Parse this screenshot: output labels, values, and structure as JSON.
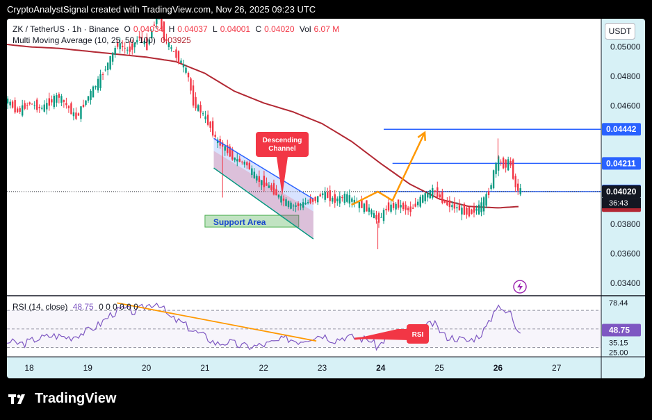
{
  "header": {
    "caption": "CryptoAnalystSignal created with TradingView.com, Nov 26, 2025 09:23 UTC"
  },
  "currency_button": "USDT",
  "symbol_legend": {
    "symbol": "ZK / TetherUS · 1h · Binance",
    "o_label": "O",
    "o_value": "0.04034",
    "h_label": "H",
    "h_value": "0.04037",
    "l_label": "L",
    "l_value": "0.04001",
    "c_label": "C",
    "c_value": "0.04020",
    "vol_label": "Vol",
    "vol_value": "6.07 M"
  },
  "ma_legend": {
    "name": "Multi Moving Average (10, 25, 50, 100)",
    "value": "0.03925"
  },
  "rsi_legend": {
    "name": "RSI (14, close)",
    "value": "48.75",
    "extras": "0 0 0 0 0 0"
  },
  "annotations": {
    "descending_channel": [
      "Descending",
      "Channel"
    ],
    "support_area": "Support Area",
    "rsi": "RSI"
  },
  "colors": {
    "up": "#089981",
    "down": "#f23645",
    "ma": "#b22833",
    "level": "#2962ff",
    "arrow": "#ff9800",
    "rsi": "#7e57c2",
    "callout": "#f23645"
  },
  "brand": "TradingView",
  "countdown": "36:43",
  "chart_data": [
    {
      "type": "candlestick",
      "x_ticks": [
        "18",
        "19",
        "20",
        "21",
        "22",
        "23",
        "24",
        "25",
        "26",
        "27"
      ],
      "y_ticks": [
        "0.05000",
        "0.04800",
        "0.04600",
        "0.03800",
        "0.03600",
        "0.03400"
      ],
      "ylim": [
        0.0332,
        0.0519
      ],
      "price_labels": [
        {
          "value": 0.04442,
          "text": "0.04442",
          "color": "#2962ff"
        },
        {
          "value": 0.04211,
          "text": "0.04211",
          "color": "#2962ff"
        },
        {
          "value": 0.04025,
          "text": "0.04025",
          "color": "#2962ff"
        },
        {
          "value": 0.0402,
          "text": "0.04020",
          "color": "#131722"
        },
        {
          "value": 0.03925,
          "text": "0.03925",
          "color": "#b22833"
        }
      ],
      "horizontal_levels": [
        {
          "value": 0.04442,
          "from_day": 24.05,
          "to_day": 28
        },
        {
          "value": 0.04211,
          "from_day": 24.2,
          "to_day": 28
        },
        {
          "value": 0.0402,
          "from_day": 23.9,
          "to_day": 28
        }
      ],
      "price_path": [
        [
          17.3,
          0.0473
        ],
        [
          17.5,
          0.0469
        ],
        [
          17.8,
          0.0456
        ],
        [
          18.0,
          0.0462
        ],
        [
          18.2,
          0.0458
        ],
        [
          18.5,
          0.0467
        ],
        [
          18.8,
          0.0452
        ],
        [
          19.0,
          0.0466
        ],
        [
          19.2,
          0.0478
        ],
        [
          19.4,
          0.0493
        ],
        [
          19.5,
          0.0502
        ],
        [
          19.7,
          0.0497
        ],
        [
          19.9,
          0.0508
        ],
        [
          20.0,
          0.0499
        ],
        [
          20.1,
          0.0512
        ],
        [
          20.2,
          0.0525
        ],
        [
          20.3,
          0.0506
        ],
        [
          20.5,
          0.0494
        ],
        [
          20.6,
          0.0489
        ],
        [
          20.7,
          0.0482
        ],
        [
          20.8,
          0.0462
        ],
        [
          20.9,
          0.0458
        ],
        [
          21.0,
          0.0452
        ],
        [
          21.1,
          0.0445
        ],
        [
          21.2,
          0.0436
        ],
        [
          21.3,
          0.0433
        ],
        [
          21.5,
          0.0424
        ],
        [
          21.7,
          0.0421
        ],
        [
          21.9,
          0.041
        ],
        [
          22.1,
          0.0405
        ],
        [
          22.3,
          0.0397
        ],
        [
          22.5,
          0.0392
        ],
        [
          22.7,
          0.0394
        ],
        [
          22.9,
          0.0397
        ],
        [
          23.0,
          0.0401
        ],
        [
          23.2,
          0.0396
        ],
        [
          23.4,
          0.0399
        ],
        [
          23.6,
          0.0394
        ],
        [
          23.8,
          0.039
        ],
        [
          23.95,
          0.0382
        ],
        [
          24.1,
          0.0391
        ],
        [
          24.3,
          0.0393
        ],
        [
          24.5,
          0.0389
        ],
        [
          24.7,
          0.0398
        ],
        [
          24.9,
          0.0403
        ],
        [
          25.1,
          0.0394
        ],
        [
          25.3,
          0.0391
        ],
        [
          25.5,
          0.0387
        ],
        [
          25.7,
          0.0392
        ],
        [
          25.85,
          0.0402
        ],
        [
          25.95,
          0.0419
        ],
        [
          26.0,
          0.0424
        ],
        [
          26.1,
          0.0419
        ],
        [
          26.2,
          0.0423
        ],
        [
          26.3,
          0.0405
        ],
        [
          26.4,
          0.0402
        ]
      ],
      "wicks": [
        [
          21.3,
          0.0398
        ],
        [
          23.95,
          0.0363
        ],
        [
          26.0,
          0.0438
        ]
      ],
      "ma_path": [
        [
          17.3,
          0.0503
        ],
        [
          18.0,
          0.05
        ],
        [
          18.5,
          0.0499
        ],
        [
          19.0,
          0.0497
        ],
        [
          19.5,
          0.0495
        ],
        [
          20.0,
          0.0493
        ],
        [
          20.5,
          0.049
        ],
        [
          21.0,
          0.0482
        ],
        [
          21.5,
          0.047
        ],
        [
          22.0,
          0.0462
        ],
        [
          22.5,
          0.0456
        ],
        [
          23.0,
          0.0448
        ],
        [
          23.5,
          0.0436
        ],
        [
          24.0,
          0.0421
        ],
        [
          24.5,
          0.0407
        ],
        [
          25.0,
          0.0397
        ],
        [
          25.5,
          0.0392
        ],
        [
          26.0,
          0.0391
        ],
        [
          26.4,
          0.0392
        ]
      ],
      "channel": {
        "upper": [
          [
            21.15,
            0.0438
          ],
          [
            22.85,
            0.0397
          ]
        ],
        "lower": [
          [
            21.15,
            0.0418
          ],
          [
            22.85,
            0.037
          ]
        ]
      },
      "support_area": {
        "x_from": 21.0,
        "x_to": 22.6,
        "y_from": 0.0378,
        "y_to": 0.0386
      },
      "projection_arrow": [
        [
          23.5,
          0.0393
        ],
        [
          23.95,
          0.0402
        ],
        [
          24.2,
          0.0396
        ],
        [
          24.75,
          0.0442
        ]
      ]
    },
    {
      "type": "line",
      "name": "RSI",
      "ylim": [
        20,
        85
      ],
      "y_tick_labels": [
        "78.44",
        "35.15",
        "25.00"
      ],
      "current": 48.75,
      "reference_lines": [
        70,
        50,
        30
      ],
      "values": [
        [
          17.3,
          30
        ],
        [
          17.6,
          36
        ],
        [
          17.9,
          34
        ],
        [
          18.1,
          39
        ],
        [
          18.4,
          43
        ],
        [
          18.7,
          41
        ],
        [
          19.0,
          48
        ],
        [
          19.2,
          55
        ],
        [
          19.4,
          66
        ],
        [
          19.6,
          72
        ],
        [
          19.8,
          68
        ],
        [
          20.0,
          75
        ],
        [
          20.2,
          79
        ],
        [
          20.4,
          62
        ],
        [
          20.6,
          57
        ],
        [
          20.8,
          48
        ],
        [
          21.0,
          42
        ],
        [
          21.2,
          34
        ],
        [
          21.4,
          36
        ],
        [
          21.6,
          32
        ],
        [
          21.8,
          31
        ],
        [
          22.0,
          33
        ],
        [
          22.2,
          36
        ],
        [
          22.4,
          40
        ],
        [
          22.6,
          37
        ],
        [
          22.8,
          41
        ],
        [
          23.0,
          44
        ],
        [
          23.2,
          38
        ],
        [
          23.4,
          42
        ],
        [
          23.6,
          40
        ],
        [
          23.8,
          39
        ],
        [
          23.95,
          30
        ],
        [
          24.1,
          42
        ],
        [
          24.3,
          45
        ],
        [
          24.5,
          40
        ],
        [
          24.7,
          51
        ],
        [
          24.9,
          56
        ],
        [
          25.1,
          42
        ],
        [
          25.3,
          40
        ],
        [
          25.5,
          37
        ],
        [
          25.7,
          44
        ],
        [
          25.85,
          56
        ],
        [
          25.95,
          72
        ],
        [
          26.0,
          79
        ],
        [
          26.1,
          66
        ],
        [
          26.2,
          70
        ],
        [
          26.3,
          53
        ],
        [
          26.4,
          48.75
        ]
      ],
      "trendline": [
        [
          19.5,
          78
        ],
        [
          22.9,
          37
        ]
      ]
    }
  ]
}
